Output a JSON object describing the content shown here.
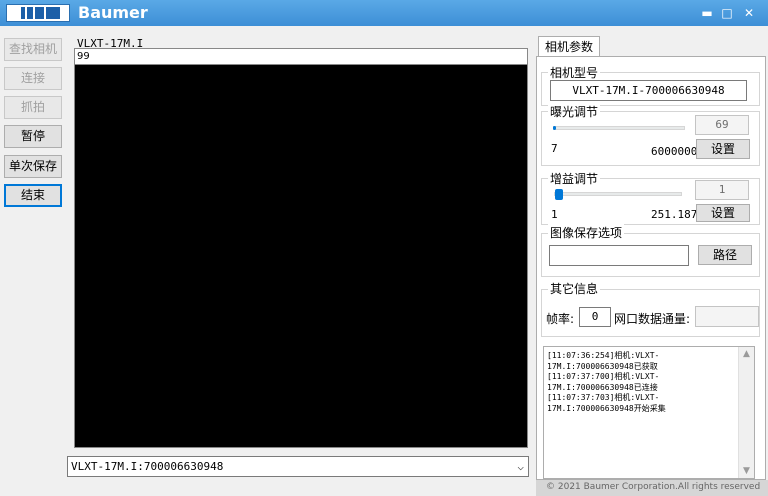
{
  "title": {
    "brand": "Baumer",
    "minimize": "▬",
    "maximize": "□",
    "close": "✕"
  },
  "left_buttons": {
    "find_camera": "查找相机",
    "connect": "连接",
    "capture": "抓拍",
    "pause": "暂停",
    "single_save": "单次保存",
    "end": "结束"
  },
  "center": {
    "camera_label": "VLXT-17M.I",
    "image_value": "99",
    "device_select": "VLXT-17M.I:700006630948"
  },
  "panel": {
    "tab": "相机参数",
    "model_title": "相机型号",
    "model_value": "VLXT-17M.I-700006630948",
    "exposure_title": "曝光调节",
    "exposure_value": "69",
    "exposure_min": "7",
    "exposure_max": "60000000",
    "exposure_level": 0.0,
    "exposure_set": "设置",
    "gain_title": "增益调节",
    "gain_value": "1",
    "gain_min": "1",
    "gain_max": "251.1875",
    "gain_level": 0.0,
    "gain_set": "设置",
    "save_title": "图像保存选项",
    "save_path_value": "",
    "path_button": "路径",
    "other_title": "其它信息",
    "fps_label": "帧率:",
    "fps_value": "0",
    "net_label": "网口数据通量:",
    "net_value": ""
  },
  "log_lines": [
    "[11:07:36:254]相机:VLXT-",
    "17M.I:700006630948已获取",
    "[11:07:37:700]相机:VLXT-",
    "17M.I:700006630948已连接",
    "[11:07:37:703]相机:VLXT-",
    "17M.I:700006630948开始采集"
  ],
  "footer": "© 2021 Baumer Corporation.All rights reserved",
  "colors": {
    "titlebar": "#4a9be0",
    "accent": "#0078d7"
  }
}
